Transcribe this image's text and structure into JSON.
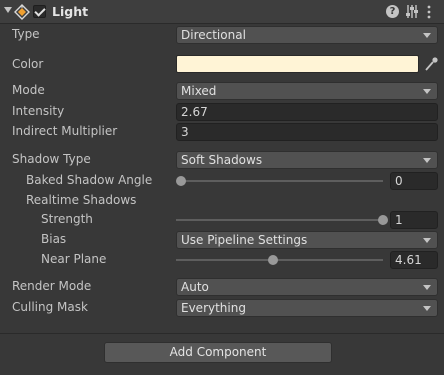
{
  "header": {
    "title": "Light",
    "enabled": true,
    "help_glyph": "?",
    "icons": [
      "foldout-arrow-icon",
      "directional-light-icon",
      "enabled-checkbox",
      "help-icon",
      "presets-icon",
      "context-menu-icon"
    ]
  },
  "fields": {
    "type": {
      "label": "Type",
      "value": "Directional"
    },
    "color": {
      "label": "Color",
      "value": "#fff4d6"
    },
    "mode": {
      "label": "Mode",
      "value": "Mixed"
    },
    "intensity": {
      "label": "Intensity",
      "value": "2.67"
    },
    "indirect_multiplier": {
      "label": "Indirect Multiplier",
      "value": "3"
    },
    "shadow_type": {
      "label": "Shadow Type",
      "value": "Soft Shadows"
    },
    "baked_shadow_angle": {
      "label": "Baked Shadow Angle",
      "value": "0",
      "fraction": 0.0
    },
    "realtime_shadows": {
      "label": "Realtime Shadows"
    },
    "strength": {
      "label": "Strength",
      "value": "1",
      "fraction": 1.0
    },
    "bias": {
      "label": "Bias",
      "value": "Use Pipeline Settings"
    },
    "near_plane": {
      "label": "Near Plane",
      "value": "4.61",
      "fraction": 0.47
    },
    "render_mode": {
      "label": "Render Mode",
      "value": "Auto"
    },
    "culling_mask": {
      "label": "Culling Mask",
      "value": "Everything"
    }
  },
  "footer": {
    "add_component_label": "Add Component"
  }
}
